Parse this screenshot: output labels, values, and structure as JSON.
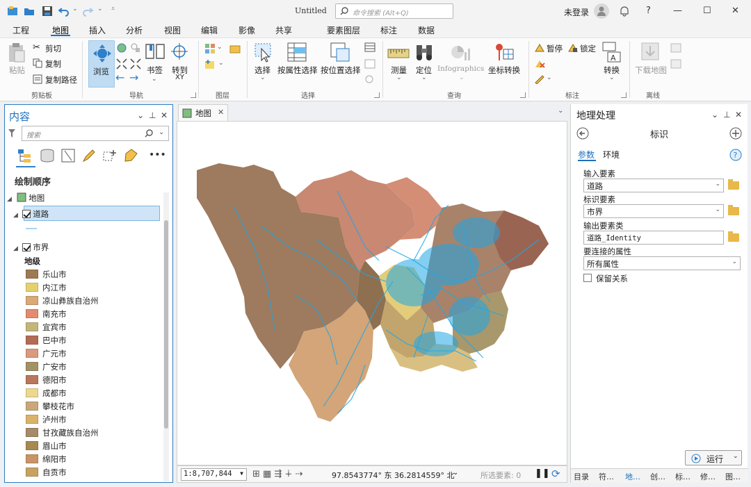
{
  "window": {
    "title": "Untitled",
    "command_search_placeholder": "命令搜索 (Alt+Q)",
    "login": "未登录"
  },
  "menu": {
    "tabs": [
      "工程",
      "地图",
      "插入",
      "分析",
      "视图",
      "编辑",
      "影像",
      "共享"
    ],
    "active": "地图",
    "context_tabs": [
      "要素图层",
      "标注",
      "数据"
    ]
  },
  "ribbon": {
    "clipboard": {
      "paste": "粘贴",
      "cut": "剪切",
      "copy": "复制",
      "copy_path": "复制路径",
      "group": "剪贴板"
    },
    "navigate": {
      "explore": "浏览",
      "bookmarks": "书签",
      "goto_xy": "转到",
      "goto_xy_sub": "XY",
      "group": "导航"
    },
    "layer": {
      "group": "图层"
    },
    "selection": {
      "select": "选择",
      "by_attr": "按属性选择",
      "by_location": "按位置选择",
      "group": "选择"
    },
    "inquiry": {
      "measure": "测量",
      "locate": "定位",
      "infographics": "Infographics",
      "coord_convert": "坐标转换",
      "group": "查询"
    },
    "labeling": {
      "pause": "暂停",
      "lock": "锁定",
      "convert": "转换",
      "group": "标注"
    },
    "offline": {
      "download_map": "下载地图",
      "group": "离线"
    }
  },
  "contents": {
    "title": "内容",
    "search_placeholder": "搜索",
    "draw_order": "绘制顺序",
    "map_layer": "地图",
    "roads_layer": "道路",
    "city_layer": "市界",
    "legend_field": "地级",
    "legend": [
      {
        "name": "乐山市",
        "color": "#9e7a52"
      },
      {
        "name": "内江市",
        "color": "#e6d06e"
      },
      {
        "name": "凉山彝族自治州",
        "color": "#d9a976"
      },
      {
        "name": "南充市",
        "color": "#e38b70"
      },
      {
        "name": "宜宾市",
        "color": "#c4b57a"
      },
      {
        "name": "巴中市",
        "color": "#b36b55"
      },
      {
        "name": "广元市",
        "color": "#d99a7e"
      },
      {
        "name": "广安市",
        "color": "#a39266"
      },
      {
        "name": "德阳市",
        "color": "#b9775c"
      },
      {
        "name": "成都市",
        "color": "#eed88e"
      },
      {
        "name": "攀枝花市",
        "color": "#c9a77a"
      },
      {
        "name": "泸州市",
        "color": "#d9b36a"
      },
      {
        "name": "甘孜藏族自治州",
        "color": "#a68a6a"
      },
      {
        "name": "眉山市",
        "color": "#a68a52"
      },
      {
        "name": "绵阳市",
        "color": "#c99466"
      },
      {
        "name": "自贡市",
        "color": "#c7a260"
      }
    ]
  },
  "map_view": {
    "tab_label": "地图",
    "scale": "1:8,707,844",
    "coordinates": "97.8543774° 东  36.2814559° 北",
    "selected_features": "所选要素: 0"
  },
  "geoprocessing": {
    "title": "地理处理",
    "tool": "标识",
    "tabs": [
      "参数",
      "环境"
    ],
    "input_label": "输入要素",
    "input_value": "道路",
    "identity_label": "标识要素",
    "identity_value": "市界",
    "output_label": "输出要素类",
    "output_value": "道路_Identity",
    "join_label": "要连接的属性",
    "join_value": "所有属性",
    "keep_relations": "保留关系",
    "run": "运行",
    "bottom_tabs": [
      "目录",
      "符…",
      "地…",
      "创…",
      "标…",
      "修…",
      "图…"
    ]
  }
}
